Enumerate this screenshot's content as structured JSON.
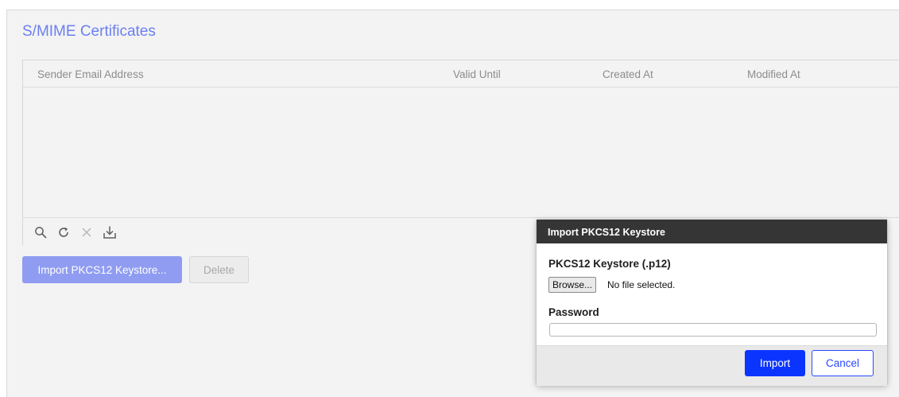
{
  "page": {
    "title": "S/MIME Certificates"
  },
  "table": {
    "columns": [
      "Sender Email Address",
      "Valid Until",
      "Created At",
      "Modified At"
    ],
    "rows": []
  },
  "toolbar": {
    "icons": [
      "search-icon",
      "refresh-icon",
      "clear-icon",
      "download-icon"
    ]
  },
  "actions": {
    "import_label": "Import PKCS12 Keystore...",
    "delete_label": "Delete"
  },
  "dialog": {
    "title": "Import PKCS12 Keystore",
    "keystore_label": "PKCS12 Keystore (.p12)",
    "browse_label": "Browse...",
    "file_status": "No file selected.",
    "password_label": "Password",
    "password_value": "",
    "import_label": "Import",
    "cancel_label": "Cancel"
  },
  "colors": {
    "accent": "#6b7ff0",
    "primary_button": "#0b35ff",
    "dialog_titlebar": "#353535"
  }
}
